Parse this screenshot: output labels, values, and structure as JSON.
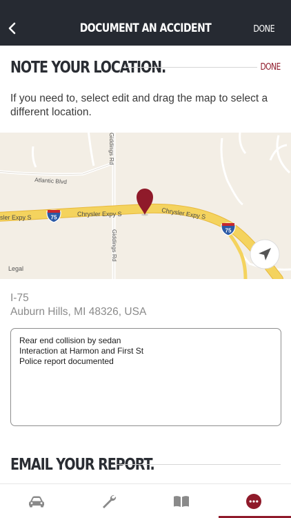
{
  "header": {
    "title": "DOCUMENT AN ACCIDENT",
    "done_label": "DONE",
    "back_icon": "chevron-left-icon"
  },
  "location_section": {
    "heading": "NOTE YOUR LOCATION.",
    "done_label": "DONE",
    "instructions": "If you need to, select edit and drag the map to select a different location."
  },
  "map": {
    "roads": {
      "giddings_top": "Giddings Rd",
      "giddings_bottom": "Giddings Rd",
      "atlantic": "Atlantic Blvd",
      "chrysler_left": "sler Expy S",
      "chrysler_mid": "Chrysler Expy S",
      "chrysler_right": "Chrysler Expy S"
    },
    "shields": [
      "75",
      "75"
    ],
    "legal": "Legal",
    "pin_color": "#8f1a2a",
    "highway_color": "#f4d35e"
  },
  "address": {
    "line1": "I-75",
    "line2": "Auburn Hills, MI 48326, USA"
  },
  "notes": {
    "lines": [
      "Rear end collision by sedan",
      "Interaction at Harmon and First St",
      "Police report documented"
    ]
  },
  "email_section": {
    "heading": "EMAIL YOUR REPORT."
  },
  "tabbar": {
    "tabs": [
      {
        "icon": "car-icon",
        "active": false
      },
      {
        "icon": "wrench-icon",
        "active": false
      },
      {
        "icon": "book-icon",
        "active": false
      },
      {
        "icon": "more-icon",
        "active": true
      }
    ],
    "accent": "#8f1a2a"
  }
}
